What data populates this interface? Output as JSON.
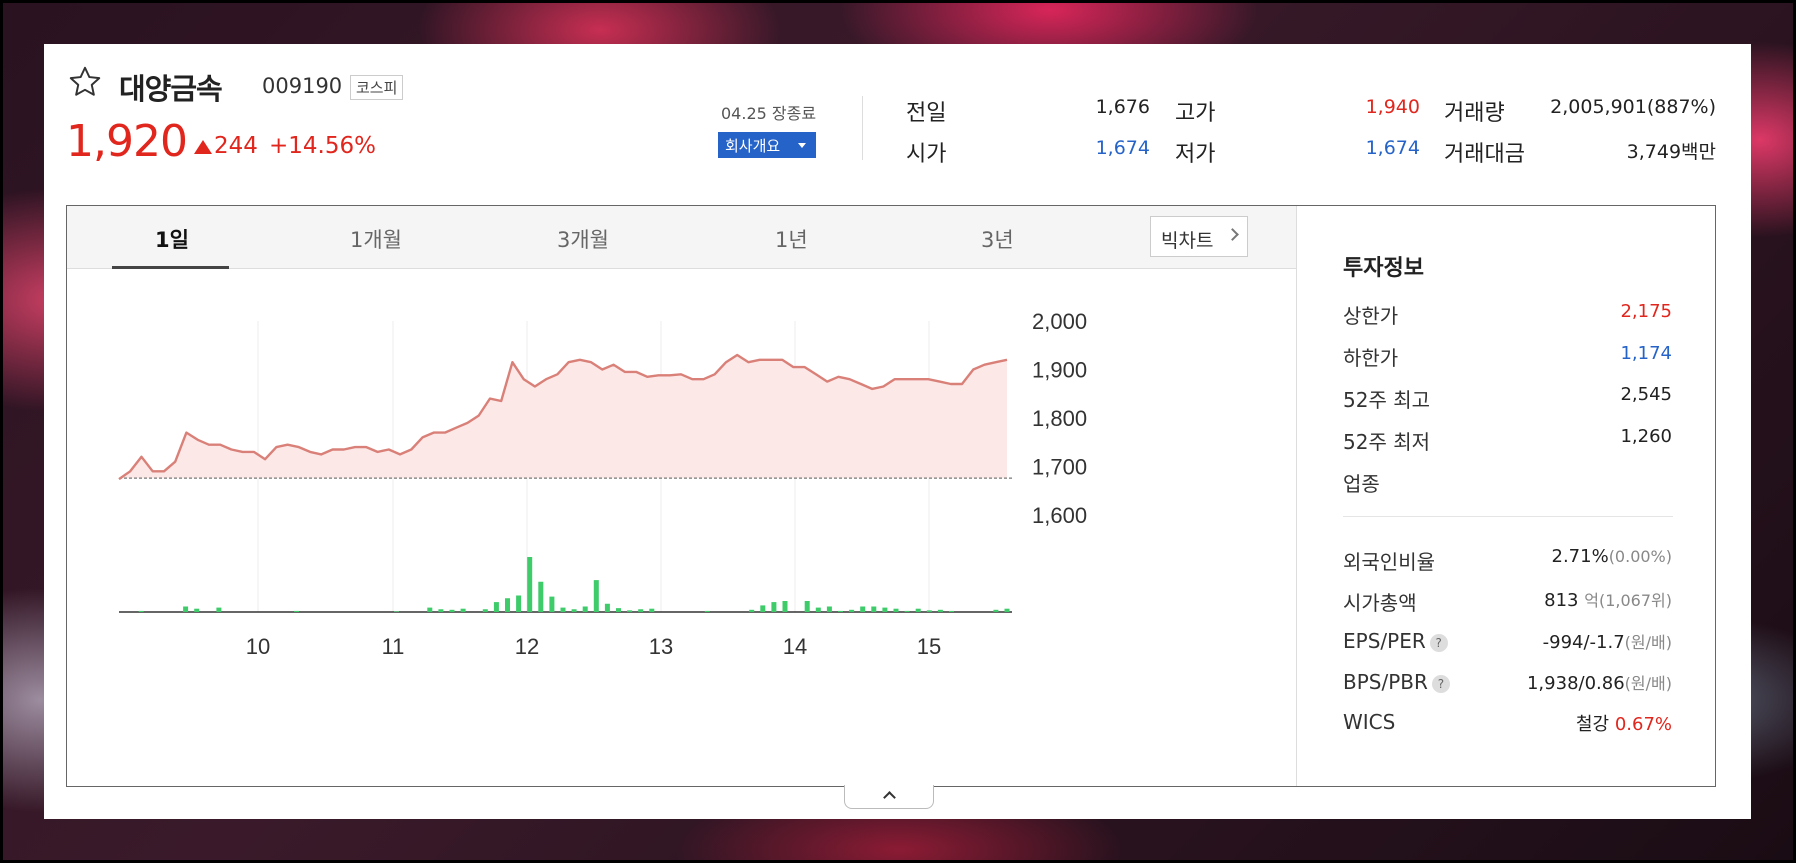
{
  "header": {
    "company_name": "대양금속",
    "stock_code": "009190",
    "market": "코스피",
    "price": "1,920",
    "change": "244",
    "change_pct": "+14.56%",
    "market_time": "04.25 장종료",
    "company_button": "회사개요"
  },
  "quotes": {
    "prev_label": "전일",
    "prev_value": "1,676",
    "open_label": "시가",
    "open_value": "1,674",
    "high_label": "고가",
    "high_value": "1,940",
    "low_label": "저가",
    "low_value": "1,674",
    "volume_label": "거래량",
    "volume_value": "2,005,901(887%)",
    "amount_label": "거래대금",
    "amount_value": "3,749백만"
  },
  "tabs": [
    "1일",
    "1개월",
    "3개월",
    "1년",
    "3년"
  ],
  "bigchart_label": "빅차트",
  "info": {
    "title": "투자정보",
    "upper_limit_label": "상한가",
    "upper_limit": "2,175",
    "lower_limit_label": "하한가",
    "lower_limit": "1,174",
    "high52_label": "52주 최고",
    "high52": "2,545",
    "low52_label": "52주 최저",
    "low52": "1,260",
    "sector_label": "업종",
    "foreign_label": "외국인비율",
    "foreign_value": "2.71%",
    "foreign_sub": "(0.00%)",
    "mcap_label": "시가총액",
    "mcap_value": "813",
    "mcap_unit": "억",
    "mcap_sub": "(1,067위)",
    "eps_label": "EPS/PER",
    "eps_value": "-994/-1.7",
    "eps_sub": "(원/배)",
    "bps_label": "BPS/PBR",
    "bps_value": "1,938/0.86",
    "bps_sub": "(원/배)",
    "wics_label": "WICS",
    "wics_value": "철강",
    "wics_pct": "0.67%"
  },
  "colors": {
    "up": "#e0261d",
    "down": "#2563c8",
    "line": "#d98078",
    "volume": "#3ecb6a"
  },
  "chart_data": {
    "type": "line",
    "x_ticks": [
      "10",
      "11",
      "12",
      "13",
      "14",
      "15"
    ],
    "y_ticks": [
      "2,000",
      "1,900",
      "1,800",
      "1,700",
      "1,600"
    ],
    "ylim": [
      1600,
      2000
    ],
    "baseline": 1676,
    "price_values": [
      1674,
      1690,
      1720,
      1690,
      1690,
      1710,
      1770,
      1755,
      1745,
      1745,
      1735,
      1730,
      1730,
      1715,
      1740,
      1745,
      1740,
      1730,
      1725,
      1735,
      1735,
      1740,
      1740,
      1730,
      1735,
      1725,
      1735,
      1760,
      1770,
      1770,
      1780,
      1790,
      1805,
      1840,
      1835,
      1915,
      1880,
      1865,
      1880,
      1890,
      1915,
      1920,
      1915,
      1900,
      1910,
      1895,
      1895,
      1885,
      1888,
      1888,
      1890,
      1880,
      1880,
      1890,
      1915,
      1930,
      1915,
      1920,
      1920,
      1920,
      1905,
      1905,
      1890,
      1875,
      1885,
      1880,
      1870,
      1860,
      1865,
      1880,
      1880,
      1880,
      1880,
      1875,
      1870,
      1870,
      1900,
      1910,
      1915,
      1920
    ],
    "volume_values": [
      0,
      0,
      2,
      0,
      0,
      0,
      10,
      6,
      0,
      8,
      0,
      0,
      0,
      0,
      0,
      0,
      2,
      0,
      0,
      0,
      0,
      0,
      0,
      0,
      0,
      1,
      0,
      0,
      8,
      5,
      4,
      6,
      0,
      5,
      18,
      25,
      30,
      100,
      55,
      28,
      8,
      5,
      10,
      58,
      15,
      7,
      3,
      5,
      6,
      0,
      0,
      0,
      0,
      2,
      0,
      0,
      0,
      4,
      12,
      18,
      20,
      0,
      20,
      8,
      10,
      2,
      4,
      10,
      10,
      8,
      6,
      2,
      6,
      3,
      4,
      2,
      0,
      0,
      0,
      4,
      6
    ]
  }
}
